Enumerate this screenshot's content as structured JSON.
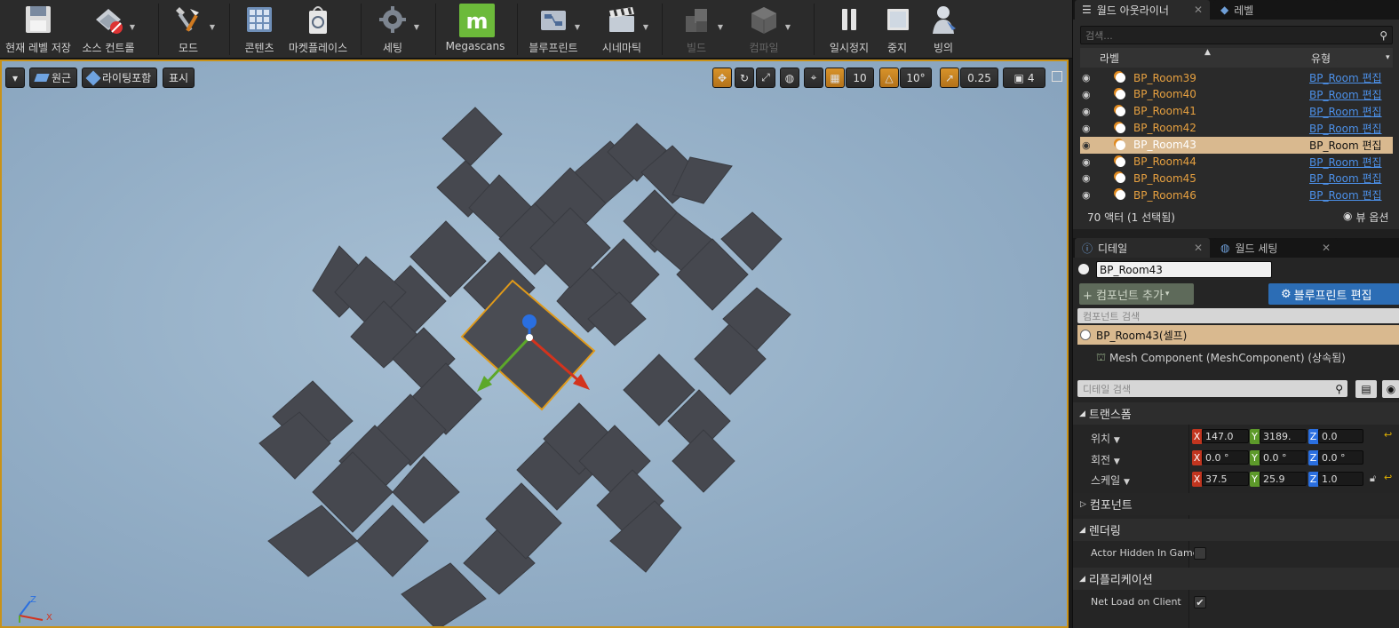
{
  "toolbar": {
    "save": "현재 레벨 저장",
    "source_control": "소스 컨트롤",
    "modes": "모드",
    "content": "콘텐츠",
    "marketplace": "마켓플레이스",
    "settings": "세팅",
    "megascans": "Megascans",
    "blueprints": "블루프린트",
    "cinematics": "시네마틱",
    "build": "빌드",
    "compile": "컴파일",
    "pause": "일시정지",
    "stop": "중지",
    "eject": "빙의"
  },
  "viewport": {
    "perspective": "원근",
    "lighting": "라이팅포함",
    "show": "표시",
    "grid_snap": "10",
    "rot_snap": "10°",
    "scale_snap": "0.25",
    "cam_speed": "4",
    "axis_z": "Z",
    "axis_x": "X"
  },
  "outliner": {
    "tab_outliner": "월드 아웃라이너",
    "tab_levels": "레벨",
    "search_placeholder": "검색...",
    "col_label": "라벨",
    "col_type": "유형",
    "rows": [
      {
        "name": "BP_Room39",
        "type": "BP_Room 편집"
      },
      {
        "name": "BP_Room40",
        "type": "BP_Room 편집"
      },
      {
        "name": "BP_Room41",
        "type": "BP_Room 편집"
      },
      {
        "name": "BP_Room42",
        "type": "BP_Room 편집"
      },
      {
        "name": "BP_Room43",
        "type": "BP_Room 편집"
      },
      {
        "name": "BP_Room44",
        "type": "BP_Room 편집"
      },
      {
        "name": "BP_Room45",
        "type": "BP_Room 편집"
      },
      {
        "name": "BP_Room46",
        "type": "BP_Room 편집"
      }
    ],
    "status": "70 액터 (1 선택됨)",
    "view_options": "뷰 옵션"
  },
  "details": {
    "tab_details": "디테일",
    "tab_world": "월드 세팅",
    "actor_name": "BP_Room43",
    "add_component": "+ 컴포넌트 추가",
    "edit_blueprint": "블루프린트 편집",
    "component_search": "컴포넌트 검색",
    "self_component": "BP_Room43(셀프)",
    "mesh_component": "Mesh Component (MeshComponent) (상속됨)",
    "detail_search": "디테일 검색",
    "transform": "트랜스폼",
    "location": "위치",
    "rotation": "회전",
    "scale": "스케일",
    "loc": {
      "x": "147.0",
      "y": "3189.",
      "z": "0.0"
    },
    "rot": {
      "x": "0.0 °",
      "y": "0.0 °",
      "z": "0.0 °"
    },
    "scl": {
      "x": "37.5",
      "y": "25.9",
      "z": "1.0"
    },
    "components": "컴포넌트",
    "rendering": "렌더링",
    "actor_hidden": "Actor Hidden In Game",
    "replication": "리플리케이션",
    "net_load": "Net Load on Client"
  }
}
